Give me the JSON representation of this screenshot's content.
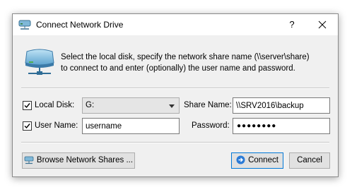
{
  "window": {
    "title": "Connect Network Drive",
    "help_label": "?",
    "title_icon": "network-drive-icon",
    "close_icon": "close-icon"
  },
  "description": {
    "line1": "Select the local disk, specify the network share name (\\\\server\\share)",
    "line2": "to connect to and enter (optionally) the user name and password.",
    "icon": "network-drive-icon"
  },
  "form": {
    "local_disk_label": "Local Disk:",
    "local_disk_checked": true,
    "local_disk_value": "G:",
    "share_name_label": "Share Name:",
    "share_name_value": "\\\\SRV2016\\backup",
    "user_name_label": "User Name:",
    "user_name_checked": true,
    "user_name_value": "username",
    "password_label": "Password:",
    "password_mask": "●●●●●●●●"
  },
  "buttons": {
    "browse_label": "Browse Network Shares ...",
    "connect_label": "Connect",
    "cancel_label": "Cancel"
  },
  "colors": {
    "accent": "#0078d7",
    "dialog_bg": "#f0f0f0"
  }
}
